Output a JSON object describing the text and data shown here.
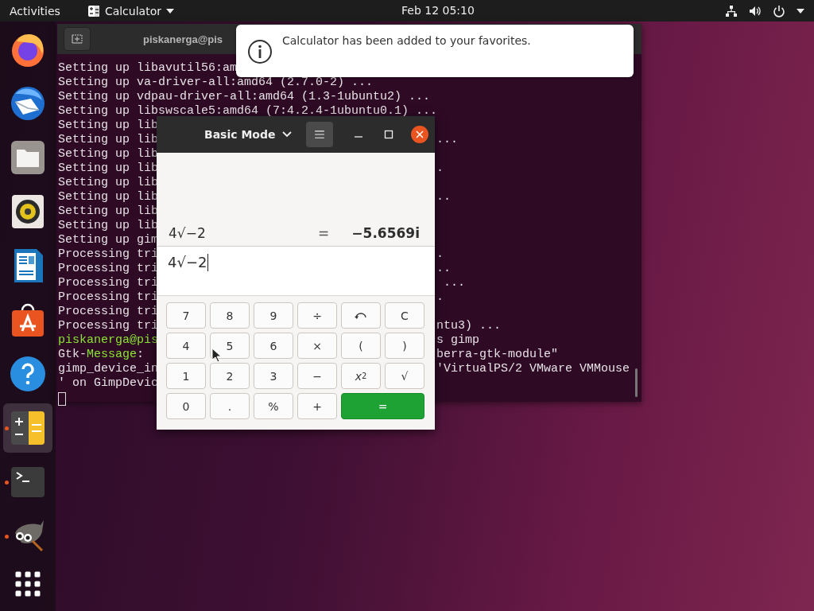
{
  "top_bar": {
    "activities": "Activities",
    "app_menu": "Calculator",
    "clock": "Feb 12  05:10"
  },
  "dock": {
    "items": [
      {
        "kind": "browser",
        "running": false,
        "selected": false
      },
      {
        "kind": "mail",
        "running": false,
        "selected": false
      },
      {
        "kind": "files",
        "running": false,
        "selected": false
      },
      {
        "kind": "music",
        "running": false,
        "selected": false
      },
      {
        "kind": "writer",
        "running": false,
        "selected": false
      },
      {
        "kind": "software",
        "running": false,
        "selected": false
      },
      {
        "kind": "help",
        "running": false,
        "selected": false
      },
      {
        "kind": "calculator",
        "running": true,
        "selected": true
      },
      {
        "kind": "terminal",
        "running": true,
        "selected": false
      },
      {
        "kind": "gimp",
        "running": true,
        "selected": false
      }
    ]
  },
  "terminal": {
    "title": "piskanerga@pis",
    "lines": [
      {
        "segments": [
          {
            "text": "Setting up libavutil56:am",
            "kind": "normal"
          }
        ]
      },
      {
        "segments": [
          {
            "text": "Setting up va-driver-all:amd64 (2.7.0-2) ...",
            "kind": "normal"
          }
        ]
      },
      {
        "segments": [
          {
            "text": "Setting up vdpau-driver-all:amd64 (1.3-1ubuntu2) ...",
            "kind": "normal"
          }
        ]
      },
      {
        "segments": [
          {
            "text": "Setting up libswscale5:amd64 (7:4.2.4-1ubuntu0.1) ...",
            "kind": "normal"
          }
        ]
      },
      {
        "segments": [
          {
            "text": "Setting up lib",
            "kind": "normal"
          }
        ]
      },
      {
        "segments": [
          {
            "text": "Setting up lib",
            "kind": "normal"
          }
        ],
        "right": "..."
      },
      {
        "segments": [
          {
            "text": "Setting up lib",
            "kind": "normal"
          }
        ]
      },
      {
        "segments": [
          {
            "text": "Setting up lib",
            "kind": "normal"
          }
        ],
        "right": "."
      },
      {
        "segments": [
          {
            "text": "Setting up lib",
            "kind": "normal"
          }
        ]
      },
      {
        "segments": [
          {
            "text": "Setting up lib",
            "kind": "normal"
          }
        ],
        "right": ".."
      },
      {
        "segments": [
          {
            "text": "Setting up lib",
            "kind": "normal"
          }
        ]
      },
      {
        "segments": [
          {
            "text": "Setting up lib",
            "kind": "normal"
          }
        ]
      },
      {
        "segments": [
          {
            "text": "Setting up gim",
            "kind": "normal"
          }
        ]
      },
      {
        "segments": [
          {
            "text": "Processing tri",
            "kind": "normal"
          }
        ],
        "right": "."
      },
      {
        "segments": [
          {
            "text": "Processing tri",
            "kind": "normal"
          }
        ],
        "right": ".."
      },
      {
        "segments": [
          {
            "text": "Processing tri",
            "kind": "normal"
          }
        ],
        "right": " ..."
      },
      {
        "segments": [
          {
            "text": "Processing tri",
            "kind": "normal"
          }
        ],
        "right": "."
      },
      {
        "segments": [
          {
            "text": "Processing tri",
            "kind": "normal"
          }
        ]
      },
      {
        "segments": [
          {
            "text": "Processing tri",
            "kind": "normal"
          }
        ],
        "right": "ntu3) ..."
      },
      {
        "segments": [
          {
            "text": "piskanerga@pis",
            "kind": "highlight"
          }
        ],
        "right": "s gimp"
      },
      {
        "segments": [
          {
            "text": "Gtk-",
            "kind": "normal"
          },
          {
            "text": "Message",
            "kind": "highlight"
          },
          {
            "text": ":",
            "kind": "normal"
          }
        ],
        "right": "berra-gtk-module\""
      },
      {
        "segments": [
          {
            "text": "gimp_device_in",
            "kind": "normal"
          }
        ],
        "right": "'VirtualPS/2 VMware VMMouse"
      },
      {
        "segments": [
          {
            "text": "' on GimpDevic",
            "kind": "normal"
          }
        ]
      }
    ]
  },
  "notification": {
    "message": "Calculator has been added to your favorites."
  },
  "calculator": {
    "mode": "Basic Mode",
    "history": {
      "expression": "4√−2",
      "equals": "=",
      "result": "−5.6569i"
    },
    "input": "4√−2",
    "buttons": [
      {
        "label": "7",
        "kind": "key"
      },
      {
        "label": "8",
        "kind": "key"
      },
      {
        "label": "9",
        "kind": "key"
      },
      {
        "label": "÷",
        "kind": "key"
      },
      {
        "kind": "undo"
      },
      {
        "label": "C",
        "kind": "key"
      },
      {
        "label": "4",
        "kind": "key"
      },
      {
        "label": "5",
        "kind": "key"
      },
      {
        "label": "6",
        "kind": "key"
      },
      {
        "label": "×",
        "kind": "key"
      },
      {
        "label": "(",
        "kind": "key"
      },
      {
        "label": ")",
        "kind": "key"
      },
      {
        "label": "1",
        "kind": "key"
      },
      {
        "label": "2",
        "kind": "key"
      },
      {
        "label": "3",
        "kind": "key"
      },
      {
        "label": "−",
        "kind": "key"
      },
      {
        "label": "*x*$^{2}$",
        "kind": "key"
      },
      {
        "label": "√",
        "kind": "key"
      },
      {
        "label": "0",
        "kind": "key"
      },
      {
        "label": ".",
        "kind": "key"
      },
      {
        "label": "%",
        "kind": "key"
      },
      {
        "label": "+",
        "kind": "key"
      },
      {
        "label": "=",
        "kind": "equals"
      }
    ]
  }
}
